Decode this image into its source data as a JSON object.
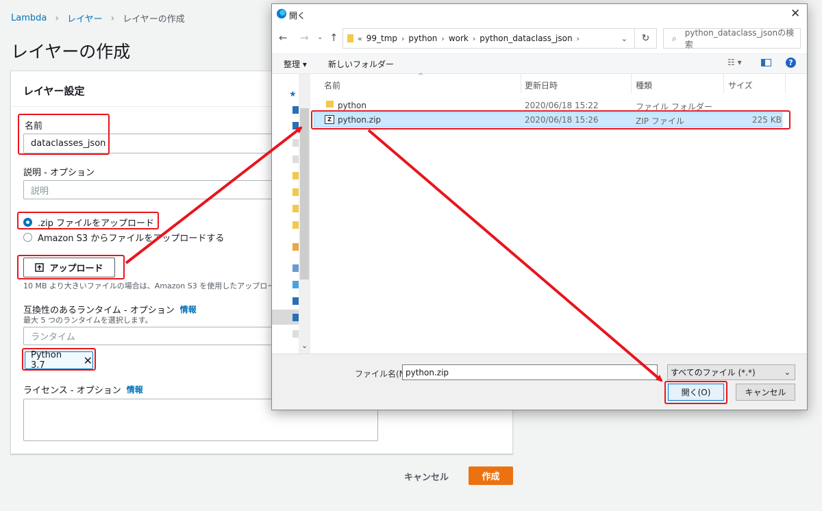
{
  "breadcrumb": {
    "root": "Lambda",
    "layers": "レイヤー",
    "current": "レイヤーの作成"
  },
  "page": {
    "title": "レイヤーの作成"
  },
  "form": {
    "section_title": "レイヤー設定",
    "name_label": "名前",
    "name_value": "dataclasses_json",
    "desc_label": "説明 - オプション",
    "desc_placeholder": "説明",
    "radio_zip": ".zip ファイルをアップロード",
    "radio_s3": "Amazon S3 からファイルをアップロードする",
    "upload_button": "アップロード",
    "upload_hint": "10 MB より大きいファイルの場合は、Amazon S3 を使用したアップロー",
    "runtime_label": "互換性のあるランタイム - オプション",
    "runtime_info": "情報",
    "runtime_hint": "最大 5 つのランタイムを選択します。",
    "runtime_placeholder": "ランタイム",
    "runtime_token": "Python 3.7",
    "license_label": "ライセンス - オプション",
    "license_info": "情報",
    "cancel": "キャンセル",
    "create": "作成"
  },
  "dialog": {
    "title": "開く",
    "path": [
      "99_tmp",
      "python",
      "work",
      "python_dataclass_json"
    ],
    "path_prefix": "«",
    "search_placeholder": "python_dataclass_jsonの検索",
    "toolbar": {
      "organize": "整理",
      "new_folder": "新しいフォルダー"
    },
    "columns": {
      "name": "名前",
      "modified": "更新日時",
      "type": "種類",
      "size": "サイズ"
    },
    "files": [
      {
        "name": "python",
        "modified": "2020/06/18 15:22",
        "type": "ファイル フォルダー",
        "size": "",
        "icon": "folder-icon"
      },
      {
        "name": "python.zip",
        "modified": "2020/06/18 15:26",
        "type": "ZIP ファイル",
        "size": "225 KB",
        "icon": "zip-icon"
      }
    ],
    "filename_label": "ファイル名(N):",
    "filename_value": "python.zip",
    "filetype_value": "すべてのファイル (*.*)",
    "open_button": "開く(O)",
    "cancel_button": "キャンセル"
  },
  "colors": {
    "annotation_red": "#e8151d",
    "aws_blue": "#0073bb",
    "aws_orange": "#ec7211",
    "selection": "#cce8ff"
  }
}
